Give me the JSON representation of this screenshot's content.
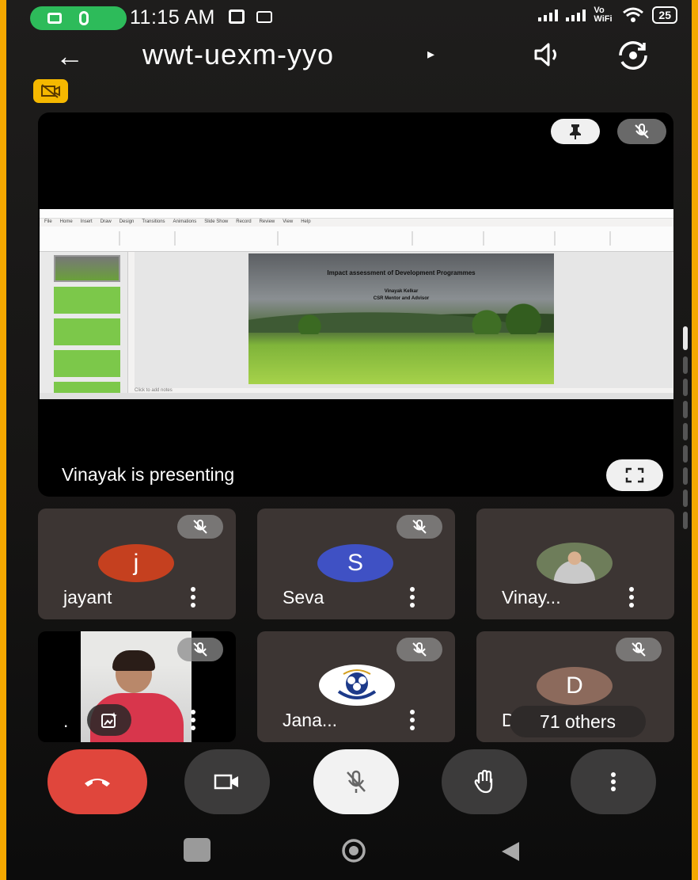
{
  "status_bar": {
    "time": "11:15 AM",
    "network_label": "Vo WiFi",
    "battery": "25"
  },
  "header": {
    "meeting_code": "wwt-uexm-yyo",
    "caret": "▸"
  },
  "presentation": {
    "presenter_label": "Vinayak is presenting",
    "slide_title": "Impact assessment of Development Programmes",
    "slide_author": "Vinayak Kelkar",
    "slide_role": "CSR Mentor and Advisor",
    "app_menu": [
      "File",
      "Home",
      "Insert",
      "Draw",
      "Design",
      "Transitions",
      "Animations",
      "Slide Show",
      "Record",
      "Review",
      "View",
      "Help"
    ],
    "notes_placeholder": "Click to add notes"
  },
  "participants": [
    {
      "name": "jayant",
      "initial": "j",
      "avatar_color": "#c5401f",
      "muted": true
    },
    {
      "name": "Seva",
      "initial": "S",
      "avatar_color": "#3f51c4",
      "muted": true
    },
    {
      "name": "Vinay...",
      "initial": "",
      "avatar_type": "photo",
      "muted": false
    },
    {
      "name": ".",
      "initial": "",
      "avatar_type": "video",
      "muted": true
    },
    {
      "name": "Jana...",
      "initial": "",
      "avatar_type": "logo",
      "muted": true
    },
    {
      "name": "Dur",
      "initial": "D",
      "avatar_color": "#8c6a5c",
      "muted": true,
      "others_label": "71 others"
    }
  ],
  "controls": [
    {
      "name": "end-call",
      "color": "#e0463c"
    },
    {
      "name": "camera",
      "color": "#3c3b3b"
    },
    {
      "name": "microphone",
      "color": "#f2f2f2"
    },
    {
      "name": "raise-hand",
      "color": "#3c3b3b"
    },
    {
      "name": "more-options",
      "color": "#3c3b3b"
    }
  ],
  "colors": {
    "frame": "#f5a800",
    "accent_green": "#2dbb5a",
    "badge_yellow": "#f5b800"
  }
}
